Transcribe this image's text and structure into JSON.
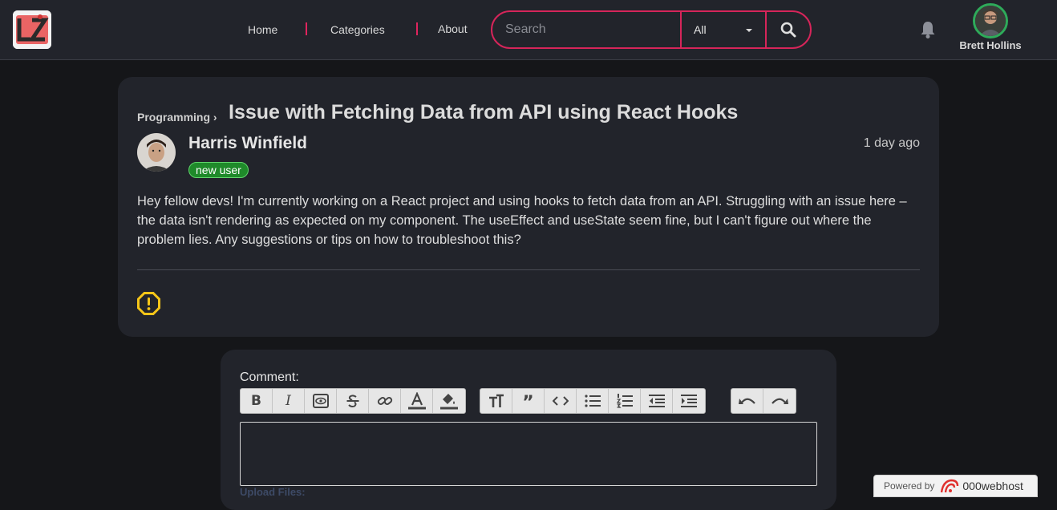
{
  "nav": {
    "logo_text": "LZ",
    "links": [
      "Home",
      "Categories",
      "About"
    ],
    "search": {
      "placeholder": "Search",
      "category_selected": "All"
    },
    "user_name": "Brett Hollins"
  },
  "post": {
    "category": "Programming",
    "separator": "›",
    "title": "Issue with Fetching Data from API using React Hooks",
    "author": "Harris Winfield",
    "author_badge": "new user",
    "time_ago": "1 day ago",
    "body": "Hey fellow devs! I'm currently working on a React project and using hooks to fetch data from an API. Struggling with an issue here – the data isn't rendering as expected on my component. The useEffect and useState seem fine, but I can't figure out where the problem lies. Any suggestions or tips on how to troubleshoot this?"
  },
  "comment": {
    "label": "Comment:",
    "upload_label": "Upload Files:",
    "toolbar_groups": [
      [
        "bold-icon",
        "italic-icon",
        "preview-icon",
        "strikethrough-icon",
        "link-icon",
        "text-color-icon",
        "highlight-icon"
      ],
      [
        "font-size-icon",
        "quote-icon",
        "code-icon",
        "bullet-list-icon",
        "numbered-list-icon",
        "outdent-icon",
        "indent-icon"
      ],
      [
        "undo-icon",
        "redo-icon"
      ]
    ]
  },
  "footer": {
    "powered_by": "Powered by",
    "brand": "000webhost"
  },
  "colors": {
    "accent": "#d6255a",
    "badge": "#1f8a2a",
    "online": "#2eab5a",
    "warning": "#f5c518"
  }
}
